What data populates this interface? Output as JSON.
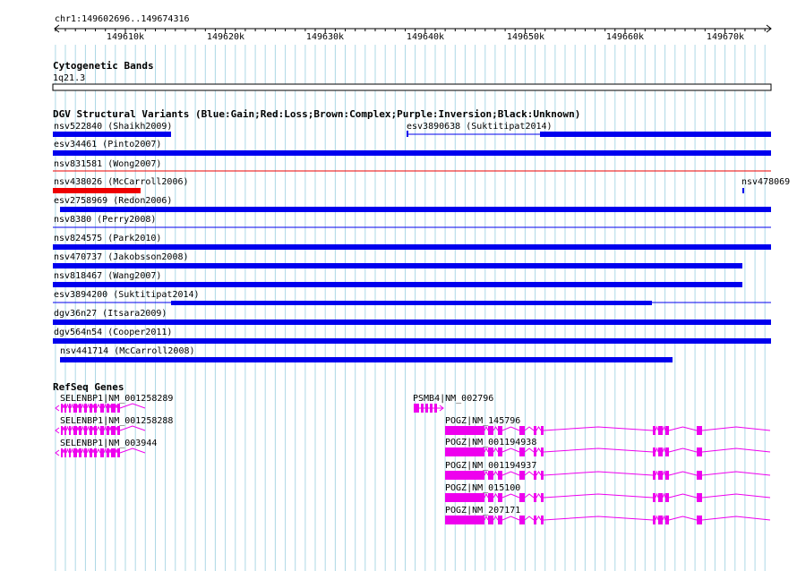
{
  "ruler": {
    "position_label": "chr1:149602696..149674316",
    "tick_labels": [
      "149610k",
      "149620k",
      "149630k",
      "149640k",
      "149650k",
      "149660k",
      "149670k"
    ]
  },
  "tracks": {
    "cytoband": {
      "title": "Cytogenetic Bands",
      "band": "1q21.3"
    },
    "dgv": {
      "title": "DGV Structural Variants (Blue:Gain;Red:Loss;Brown:Complex;Purple:Inversion;Black:Unknown)",
      "variants": [
        {
          "label": "nsv522840 (Shaikh2009)",
          "type": "gain"
        },
        {
          "label": "esv3890638 (Suktitipat2014)",
          "type": "gain"
        },
        {
          "label": "esv34461 (Pinto2007)",
          "type": "gain"
        },
        {
          "label": "nsv831581 (Wong2007)",
          "type": "loss"
        },
        {
          "label": "nsv438026 (McCarroll2006)",
          "type": "loss"
        },
        {
          "label": "nsv478069",
          "type": "gain"
        },
        {
          "label": "esv2758969 (Redon2006)",
          "type": "gain"
        },
        {
          "label": "nsv8380 (Perry2008)",
          "type": "gain"
        },
        {
          "label": "nsv824575 (Park2010)",
          "type": "gain"
        },
        {
          "label": "nsv470737 (Jakobsson2008)",
          "type": "gain"
        },
        {
          "label": "nsv818467 (Wang2007)",
          "type": "gain"
        },
        {
          "label": "esv3894200 (Suktitipat2014)",
          "type": "gain"
        },
        {
          "label": "dgv36n27 (Itsara2009)",
          "type": "gain"
        },
        {
          "label": "dgv564n54 (Cooper2011)",
          "type": "gain"
        },
        {
          "label": "nsv441714 (McCarroll2008)",
          "type": "gain"
        }
      ]
    },
    "refseq": {
      "title": "RefSeq Genes",
      "genes": [
        {
          "label": "SELENBP1|NM_001258289",
          "strand": "-"
        },
        {
          "label": "SELENBP1|NM_001258288",
          "strand": "-"
        },
        {
          "label": "SELENBP1|NM_003944",
          "strand": "-"
        },
        {
          "label": "PSMB4|NM_002796",
          "strand": "+"
        },
        {
          "label": "POGZ|NM_145796",
          "strand": "-"
        },
        {
          "label": "POGZ|NM_001194938",
          "strand": "-"
        },
        {
          "label": "POGZ|NM_001194937",
          "strand": "-"
        },
        {
          "label": "POGZ|NM_015100",
          "strand": "-"
        },
        {
          "label": "POGZ|NM_207171",
          "strand": "-"
        }
      ]
    }
  },
  "colors": {
    "gain": "#0000ee",
    "loss": "#ee0000",
    "gene": "#ee00ee",
    "grid": "#add8e6"
  }
}
